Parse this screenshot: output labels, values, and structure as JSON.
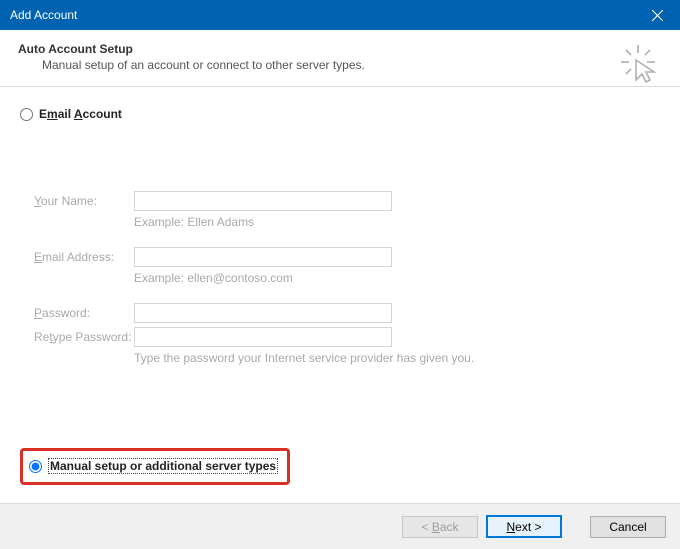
{
  "window": {
    "title": "Add Account"
  },
  "header": {
    "title": "Auto Account Setup",
    "subtitle": "Manual setup of an account or connect to other server types."
  },
  "options": {
    "email_account_label": "Email Account",
    "manual_label": "Manual setup or additional server types",
    "selected": "manual"
  },
  "form": {
    "your_name": {
      "label": "Your Name:",
      "value": "",
      "hint": "Example: Ellen Adams"
    },
    "email": {
      "label": "Email Address:",
      "value": "",
      "hint": "Example: ellen@contoso.com"
    },
    "password": {
      "label": "Password:",
      "value": ""
    },
    "retype": {
      "label": "Retype Password:",
      "value": "",
      "hint": "Type the password your Internet service provider has given you."
    }
  },
  "buttons": {
    "back": "< Back",
    "next": "Next >",
    "cancel": "Cancel"
  }
}
